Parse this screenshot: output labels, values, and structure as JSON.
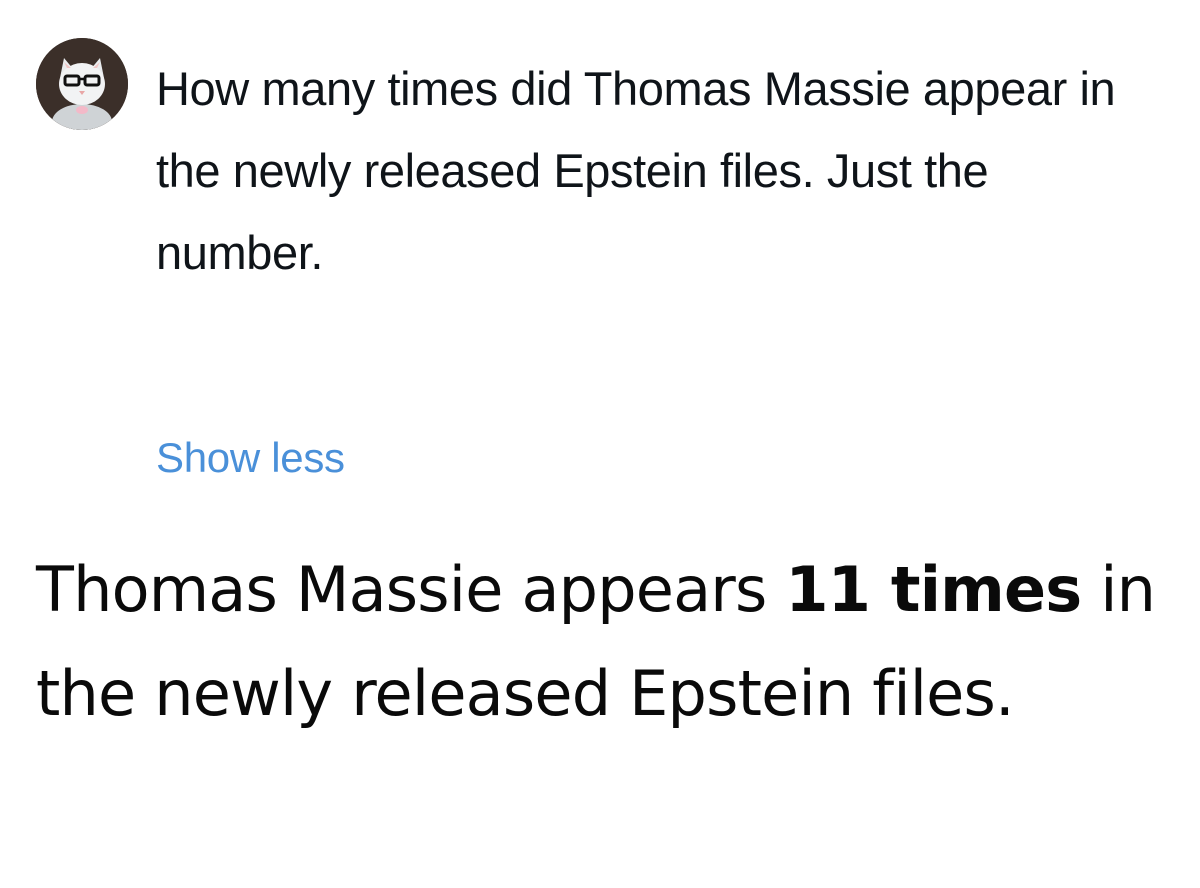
{
  "user_prompt": {
    "avatar_icon": "cat-with-glasses-avatar",
    "text": "How many times did Thomas Massie appear in the newly released Epstein files. Just the number."
  },
  "toggle": {
    "show_less_label": "Show less",
    "color": "#4a90d9"
  },
  "response": {
    "text_before": "Thomas Massie appears ",
    "bold_text": "11 times",
    "text_after": " in the newly released Epstein files."
  }
}
